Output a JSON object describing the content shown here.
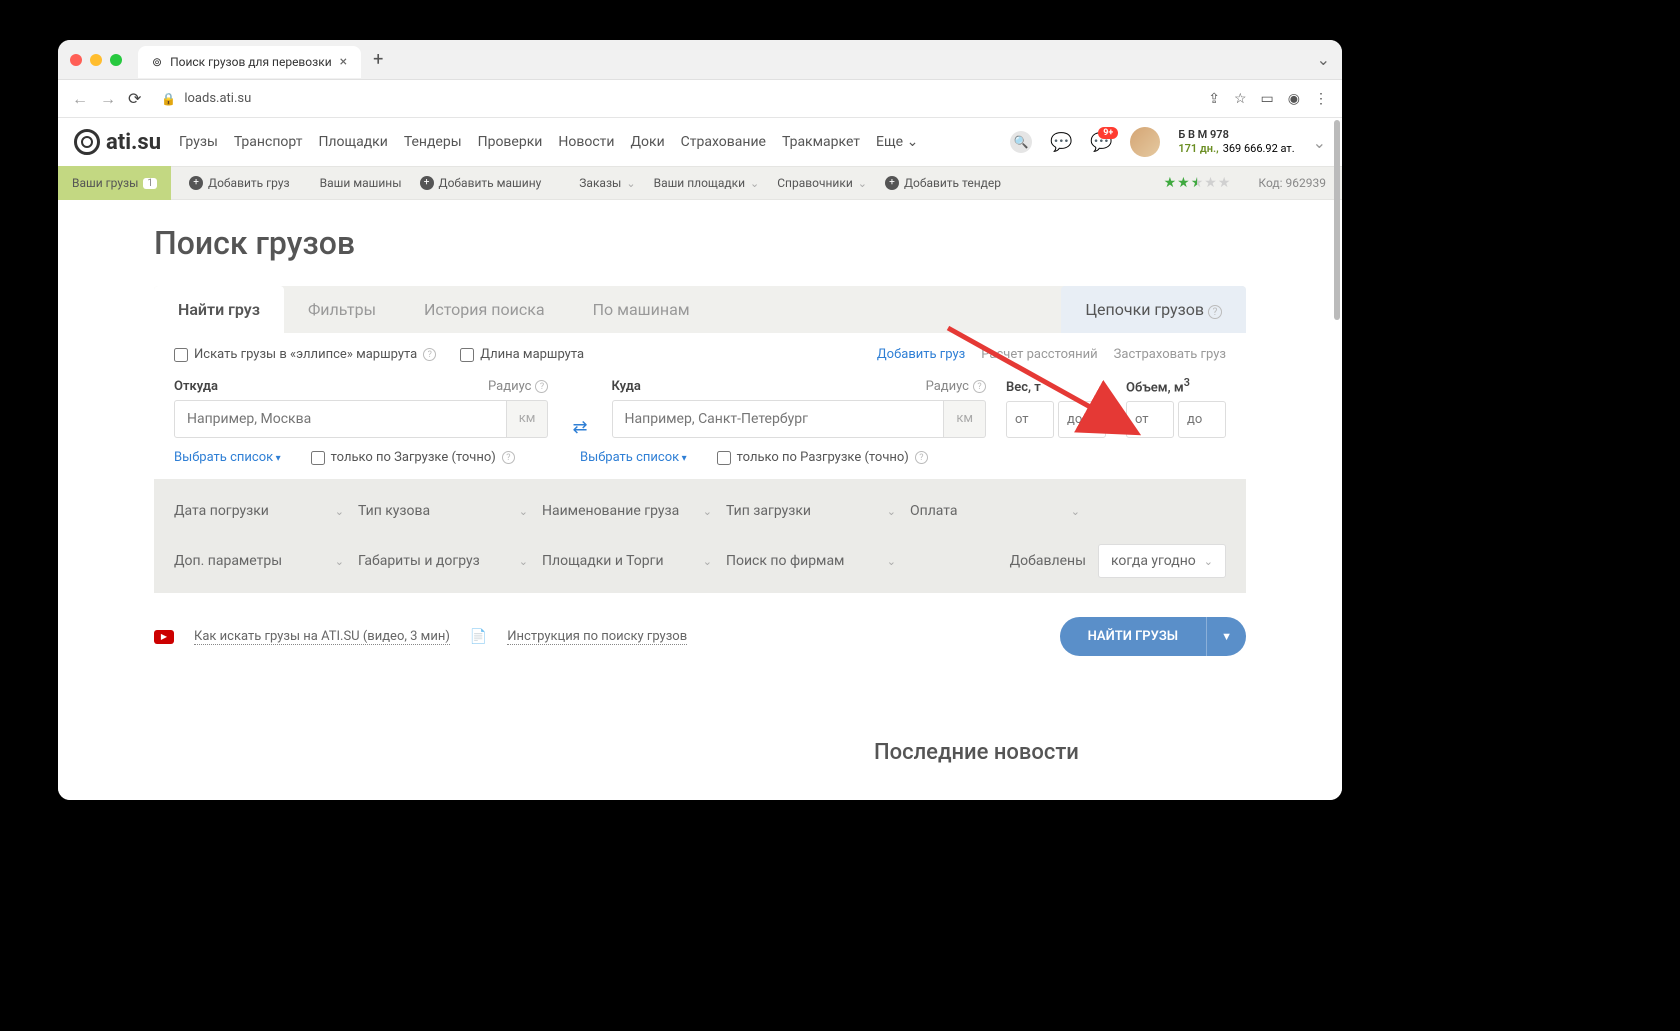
{
  "browser": {
    "tab_title": "Поиск грузов для перевозки",
    "url": "loads.ati.su"
  },
  "header": {
    "logo": "ati.su",
    "nav": [
      "Грузы",
      "Транспорт",
      "Площадки",
      "Тендеры",
      "Проверки",
      "Новости",
      "Доки",
      "Страхование",
      "Тракмаркет",
      "Еще"
    ],
    "notif_badge": "9+",
    "user_name": "Б В М 978",
    "user_days": "171 дн.,",
    "user_balance": "369 666.92 ат."
  },
  "toolbar": {
    "your_loads": "Ваши грузы",
    "your_loads_count": "1",
    "add_load": "Добавить груз",
    "your_trucks": "Ваши машины",
    "add_truck": "Добавить машину",
    "orders": "Заказы",
    "your_platforms": "Ваши площадки",
    "directories": "Справочники",
    "add_tender": "Добавить тендер",
    "code_label": "Код:",
    "code": "962939"
  },
  "page": {
    "title": "Поиск грузов",
    "tabs": {
      "find": "Найти груз",
      "filters": "Фильтры",
      "history": "История поиска",
      "by_trucks": "По машинам",
      "chains": "Цепочки грузов"
    },
    "opts": {
      "ellipse": "Искать грузы в «эллипсе» маршрута",
      "route_length": "Длина маршрута",
      "add_load": "Добавить груз",
      "distance": "Расчет расстояний",
      "insure": "Застраховать груз"
    },
    "fields": {
      "from_label": "Откуда",
      "to_label": "Куда",
      "radius": "Радиус",
      "km": "км",
      "from_placeholder": "Например, Москва",
      "to_placeholder": "Например, Санкт-Петербург",
      "weight_label": "Вес, т",
      "volume_label": "Объем, м",
      "from_ph": "от",
      "to_ph": "до",
      "select_list": "Выбрать список",
      "only_load": "только по Загрузке (точно)",
      "only_unload": "только по Разгрузке (точно)"
    },
    "selectors": {
      "load_date": "Дата погрузки",
      "body_type": "Тип кузова",
      "cargo_name": "Наименование груза",
      "load_type": "Тип загрузки",
      "payment": "Оплата",
      "extra": "Доп. параметры",
      "dims": "Габариты и догруз",
      "platforms": "Площадки и Торги",
      "firm_search": "Поиск по фирмам",
      "added": "Добавлены",
      "anytime": "когда угодно"
    },
    "help": {
      "video": "Как искать грузы на ATI.SU (видео, 3 мин)",
      "instruction": "Инструкция по поиску грузов"
    },
    "find_btn": "НАЙТИ ГРУЗЫ",
    "news_title": "Последние новости"
  }
}
